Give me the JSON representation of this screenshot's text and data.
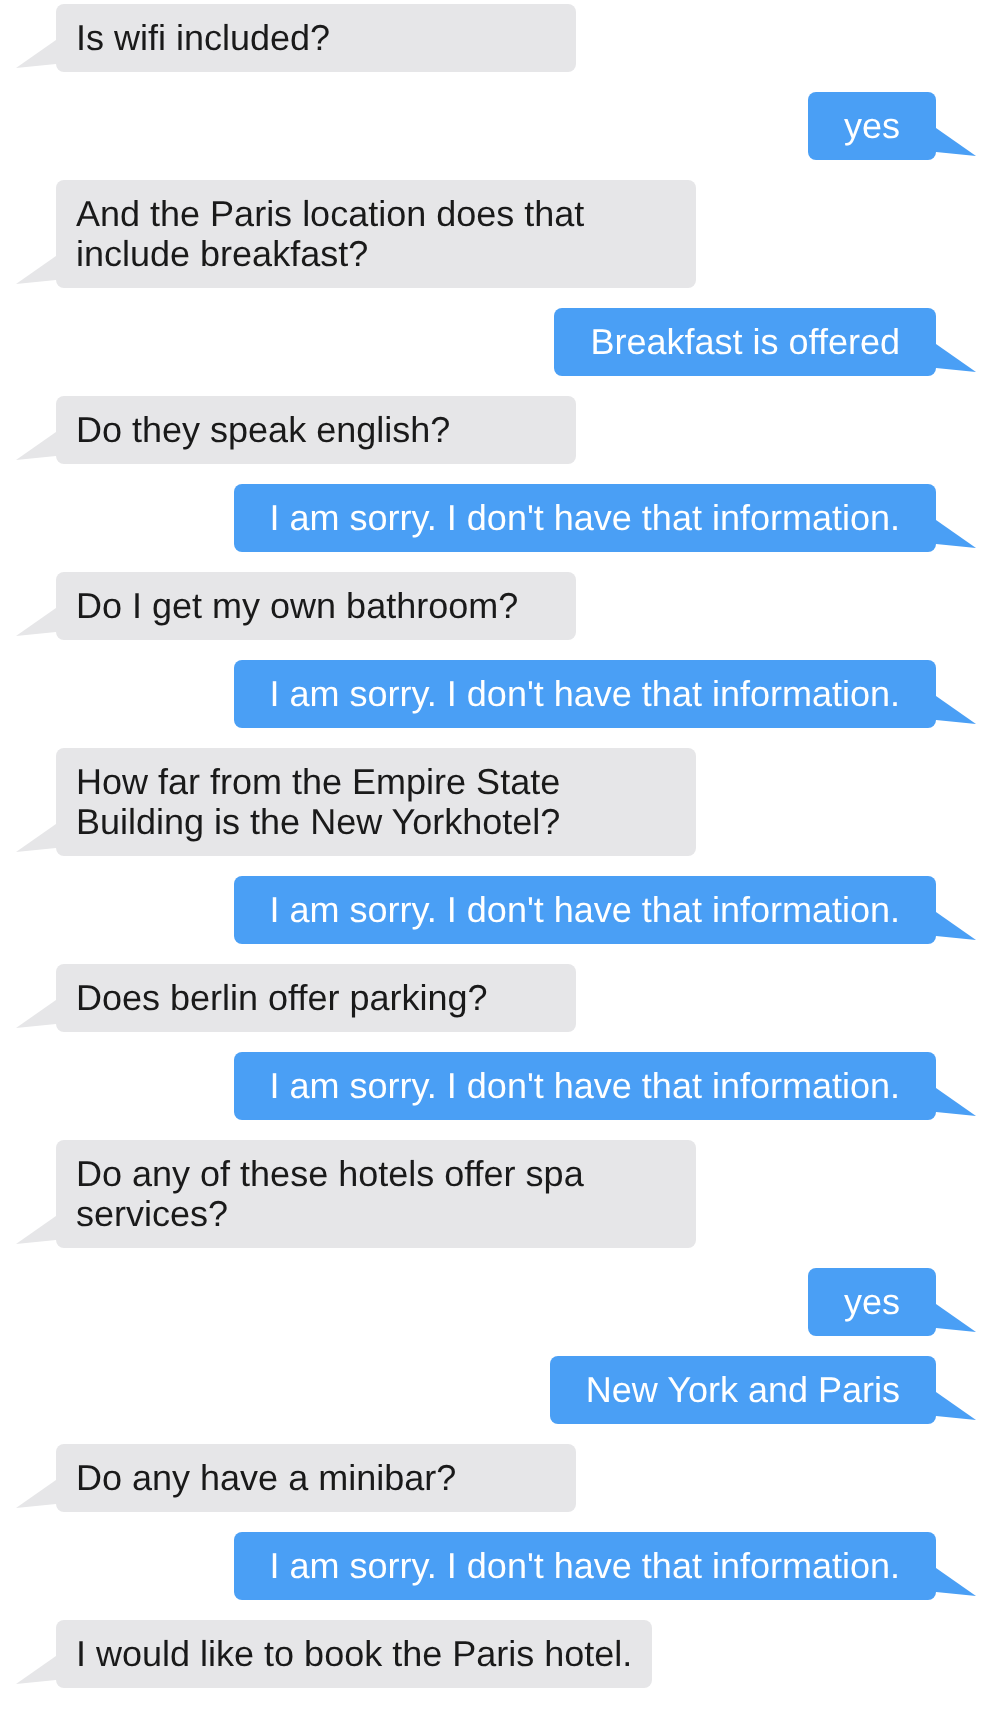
{
  "messages": [
    {
      "kind": "incoming",
      "text": "Is wifi included?"
    },
    {
      "kind": "outgoing",
      "text": "yes"
    },
    {
      "kind": "incoming",
      "text": "And the Paris location does that include breakfast?"
    },
    {
      "kind": "outgoing",
      "text": "Breakfast is offered"
    },
    {
      "kind": "incoming",
      "text": "Do they speak english?"
    },
    {
      "kind": "outgoing",
      "text": "I am sorry. I don't have that information."
    },
    {
      "kind": "incoming",
      "text": "Do I get my own bathroom?"
    },
    {
      "kind": "outgoing",
      "text": "I am sorry. I don't have that information."
    },
    {
      "kind": "incoming",
      "text": "How far from the Empire State Building is the New Yorkhotel?"
    },
    {
      "kind": "outgoing",
      "text": "I am sorry. I don't have that information."
    },
    {
      "kind": "incoming",
      "text": "Does berlin offer parking?"
    },
    {
      "kind": "outgoing",
      "text": "I am sorry. I don't have that information."
    },
    {
      "kind": "incoming",
      "text": "Do any of these hotels offer spa services?"
    },
    {
      "kind": "outgoing",
      "text": "yes"
    },
    {
      "kind": "outgoing",
      "text": "New York and Paris"
    },
    {
      "kind": "incoming",
      "text": "Do any have a minibar?"
    },
    {
      "kind": "outgoing",
      "text": "I am sorry. I don't have that information."
    },
    {
      "kind": "incoming",
      "text": "I would like to book the Paris hotel."
    }
  ]
}
